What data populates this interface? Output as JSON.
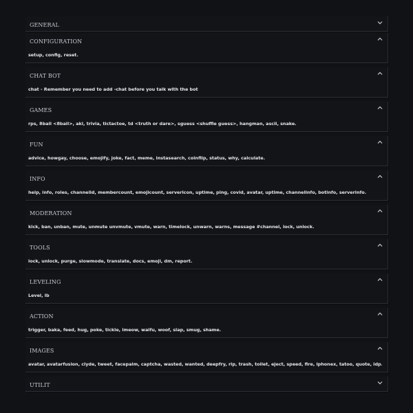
{
  "sections": [
    {
      "title": "GENERAL",
      "state": "collapsed",
      "content": "",
      "icon": "chevron-down-icon"
    },
    {
      "title": "CONFIGURATION",
      "state": "open",
      "content": "setup, config, reset.",
      "icon": "chevron-up-icon"
    },
    {
      "title": "CHAT BOT",
      "state": "open",
      "content": "chat - Remember you need to add -chat before you talk with the bot",
      "icon": "chevron-up-icon"
    },
    {
      "title": "GAMES",
      "state": "open",
      "content": "rps, 8ball <8ball>, aki, trivia, tictactoe, td <truth or dare>, sguess <shuffle guess>, hangman, ascii, snake.",
      "icon": "chevron-up-icon"
    },
    {
      "title": "FUN",
      "state": "open",
      "content": "advice, howgay, choose, emojify, joke, fact, meme, instasearch, coinflip, status, why, calculate.",
      "icon": "chevron-up-icon"
    },
    {
      "title": "INFO",
      "state": "open",
      "content": "help, info, roles, channelid, membercount, emojicount, servericon, uptime, ping, covid, avatar, uptime, channelinfo, botinfo, serverinfo.",
      "icon": "chevron-up-icon"
    },
    {
      "title": "MODERATION",
      "state": "open",
      "content": "kick, ban, unban, mute, unmute unvmute, vmute, warn, timelock, unwarn, warns, message #channel, lock, unlock.",
      "icon": "chevron-up-icon"
    },
    {
      "title": "TOOLS",
      "state": "open",
      "content": "lock, unlock, purge, slowmode, translate, docs, emoji, dm, report.",
      "icon": "chevron-up-icon"
    },
    {
      "title": "LEVELING",
      "state": "open",
      "content": "Level, lb",
      "icon": "chevron-up-icon"
    },
    {
      "title": "ACTION",
      "state": "open",
      "content": "trigger, baka, feed, hug, poke, tickle, lmeow, waifu, woof, slap, smug, shame.",
      "icon": "chevron-up-icon"
    },
    {
      "title": "IMAGES",
      "state": "open",
      "content": "avatar, avatarfusion, clyde, tweet, facepalm, captcha, wasted, wanted, deepfry, rip, trash, toilet, eject, speed, fire, iphonex, tatoo, quote, idp.",
      "icon": "chevron-up-icon"
    },
    {
      "title": "UTILIT",
      "state": "collapsed",
      "content": "",
      "icon": "chevron-down-icon"
    }
  ],
  "colors": {
    "background": "#101215",
    "panel": "#121418",
    "title": "#c9ccd2",
    "content": "#e6e8ec"
  }
}
